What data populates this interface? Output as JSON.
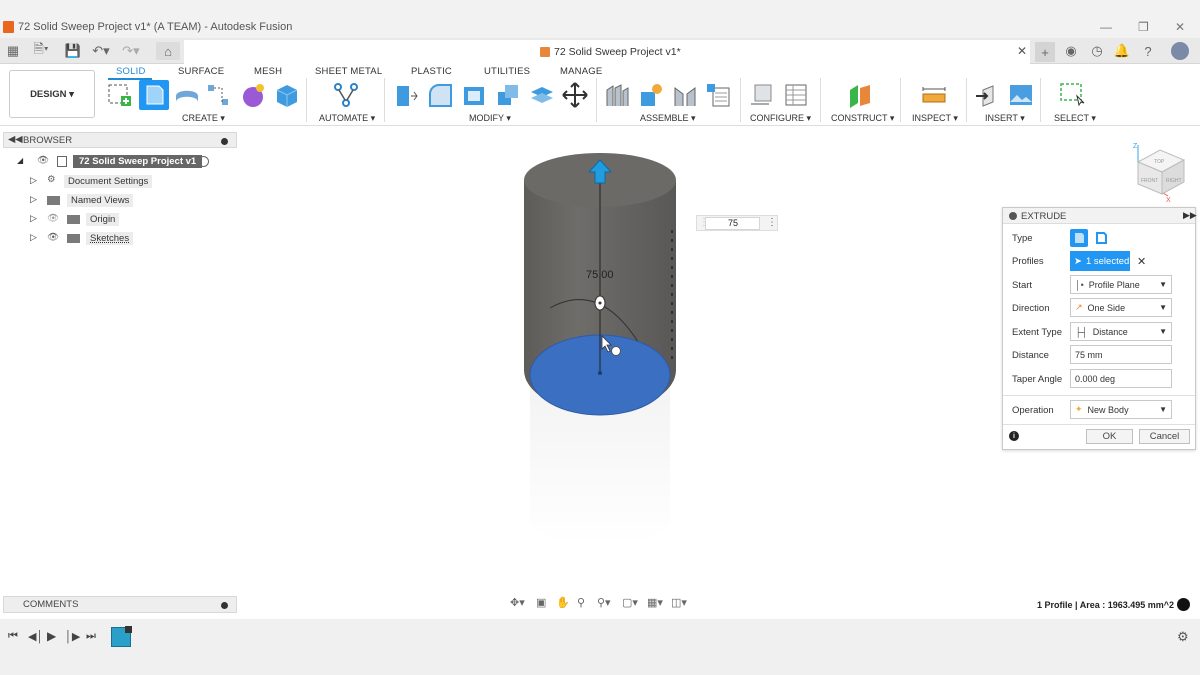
{
  "window": {
    "title": "72 Solid Sweep Project v1* (A TEAM) - Autodesk Fusion"
  },
  "tabs": {
    "document_title": "72 Solid Sweep Project v1*"
  },
  "workspace": {
    "label": "DESIGN"
  },
  "ribbon": {
    "tabs": [
      "SOLID",
      "SURFACE",
      "MESH",
      "SHEET METAL",
      "PLASTIC",
      "UTILITIES",
      "MANAGE"
    ],
    "active_tab": "SOLID",
    "groups": [
      "CREATE",
      "AUTOMATE",
      "MODIFY",
      "ASSEMBLE",
      "CONFIGURE",
      "CONSTRUCT",
      "INSPECT",
      "INSERT",
      "SELECT"
    ]
  },
  "browser": {
    "header": "BROWSER",
    "root": "72 Solid Sweep Project v1",
    "items": [
      "Document Settings",
      "Named Views",
      "Origin",
      "Sketches"
    ]
  },
  "comments": {
    "header": "COMMENTS"
  },
  "canvas": {
    "dimension_label": "75.00",
    "distance_input": "75",
    "viewcube_faces": [
      "TOP",
      "FRONT",
      "RIGHT"
    ],
    "axes": [
      "Z",
      "X"
    ]
  },
  "extrude": {
    "title": "EXTRUDE",
    "rows": [
      {
        "label": "Type"
      },
      {
        "label": "Profiles",
        "value": "1 selected"
      },
      {
        "label": "Start",
        "value": "Profile Plane"
      },
      {
        "label": "Direction",
        "value": "One Side"
      },
      {
        "label": "Extent Type",
        "value": "Distance"
      },
      {
        "label": "Distance",
        "value": "75 mm"
      },
      {
        "label": "Taper Angle",
        "value": "0.000 deg"
      },
      {
        "label": "Operation",
        "value": "New Body"
      }
    ],
    "ok": "OK",
    "cancel": "Cancel"
  },
  "status": {
    "text": "1 Profile | Area : 1963.495 mm^2"
  },
  "colors": {
    "accent": "#1f8ad6",
    "body": "#6c6a67",
    "profile": "#3b6fc2",
    "selected": "#2196f3"
  }
}
